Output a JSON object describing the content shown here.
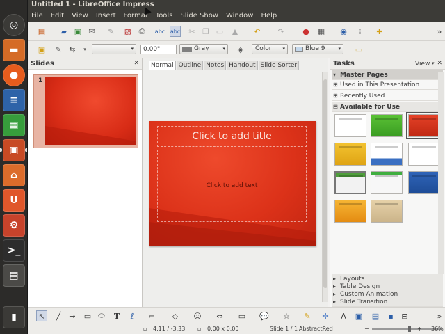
{
  "window": {
    "title": "Untitled 1 - LibreOffice Impress"
  },
  "menu": {
    "items": [
      "File",
      "Edit",
      "View",
      "Insert",
      "Format",
      "Tools",
      "Slide Show",
      "Window",
      "Help"
    ]
  },
  "toolbar2": {
    "line_width_value": "0.00\"",
    "line_color": "Gray",
    "area_style": "Color",
    "area_color": "Blue 9"
  },
  "slides_pane": {
    "title": "Slides",
    "slide_number": "1"
  },
  "view_tabs": [
    "Normal",
    "Outline",
    "Notes",
    "Handout",
    "Slide Sorter"
  ],
  "active_view_tab": "Normal",
  "slide": {
    "title_placeholder": "Click to add title",
    "content_placeholder": "Click to add text"
  },
  "tasks_pane": {
    "title": "Tasks",
    "view_label": "View",
    "close_symbol": "✕",
    "master_pages": "Master Pages",
    "used_in_presentation": "Used in This Presentation",
    "recently_used": "Recently Used",
    "available_for_use": "Available for Use",
    "bottom_sections": [
      "Layouts",
      "Table Design",
      "Custom Animation",
      "Slide Transition"
    ]
  },
  "status_bar": {
    "position": "4.11 / -3.33",
    "size": "0.00 x 0.00",
    "slide_info": "Slide 1 / 1",
    "master": "AbstractRed",
    "zoom_percent": "36%"
  },
  "colors": {
    "launcher_bg": "#2c2b29",
    "titlebar_bg": "#3c3b37",
    "slide_red": "#dc3219",
    "toolbar_bg": "#edece9"
  }
}
